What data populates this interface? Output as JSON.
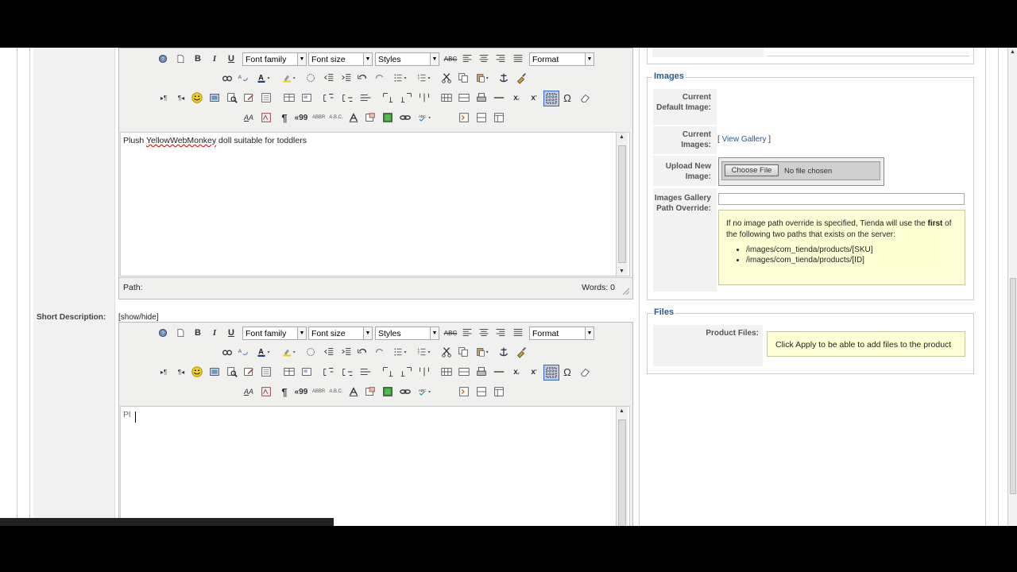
{
  "editor_toolbar": {
    "font_family": "Font family",
    "font_size": "Font size",
    "styles": "Styles",
    "format": "Format"
  },
  "long_description": {
    "content": "Plush ",
    "content_misspelled": "YellowWebMonkey",
    "content_rest": " doll suitable for toddlers",
    "path_label": "Path:",
    "words_label": "Words: 0"
  },
  "short_description": {
    "label": "Short Description:",
    "toggle": "[show/hide]",
    "content": "Pl"
  },
  "images": {
    "legend": "Images",
    "current_default_label": "Current Default Image:",
    "current_images_label": "Current Images:",
    "view_gallery": "View Gallery",
    "bracket_open": "[",
    "bracket_close": "]",
    "upload_label": "Upload New Image:",
    "choose_file": "Choose File",
    "no_file": "No file chosen",
    "gallery_override_label": "Images Gallery Path Override:",
    "override_notice_a": "If no image path override is specified, Tienda will use the ",
    "override_notice_b": "first",
    "override_notice_c": " of the following two paths that exists on the server:",
    "paths": [
      "/images/com_tienda/products/[SKU]",
      "/images/com_tienda/products/[ID]"
    ]
  },
  "files": {
    "legend": "Files",
    "product_files_label": "Product Files:",
    "notice": "Click Apply to be able to add files to the product"
  },
  "colors": {
    "legend": "#2a5a8a",
    "notice_bg": "#ffffd6",
    "link": "#1a5a9a"
  }
}
